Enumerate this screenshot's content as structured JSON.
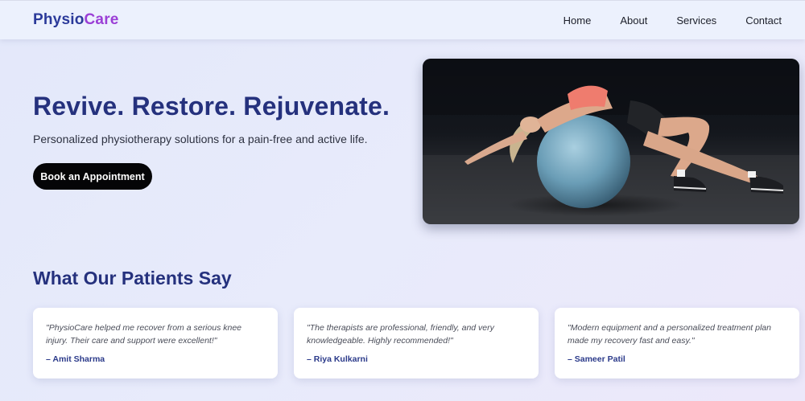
{
  "header": {
    "logo_part1": "Physio",
    "logo_part2": "Care",
    "nav": [
      "Home",
      "About",
      "Services",
      "Contact"
    ]
  },
  "hero": {
    "title": "Revive. Restore. Rejuvenate.",
    "subtitle": "Personalized physiotherapy solutions for a pain-free and active life.",
    "cta_label": "Book an Appointment",
    "image_icon": "woman-stretching-on-exercise-ball-photo"
  },
  "testimonials": {
    "heading": "What Our Patients Say",
    "items": [
      {
        "quote": "\"PhysioCare helped me recover from a serious knee injury. Their care and support were excellent!\"",
        "author": "– Amit Sharma"
      },
      {
        "quote": "\"The therapists are professional, friendly, and very knowledgeable. Highly recommended!\"",
        "author": "– Riya Kulkarni"
      },
      {
        "quote": "\"Modern equipment and a personalized treatment plan made my recovery fast and easy.\"",
        "author": "– Sameer Patil"
      }
    ]
  },
  "colors": {
    "brand_blue": "#25317d",
    "brand_purple": "#9b3fd6",
    "cta_background": "#050507"
  }
}
